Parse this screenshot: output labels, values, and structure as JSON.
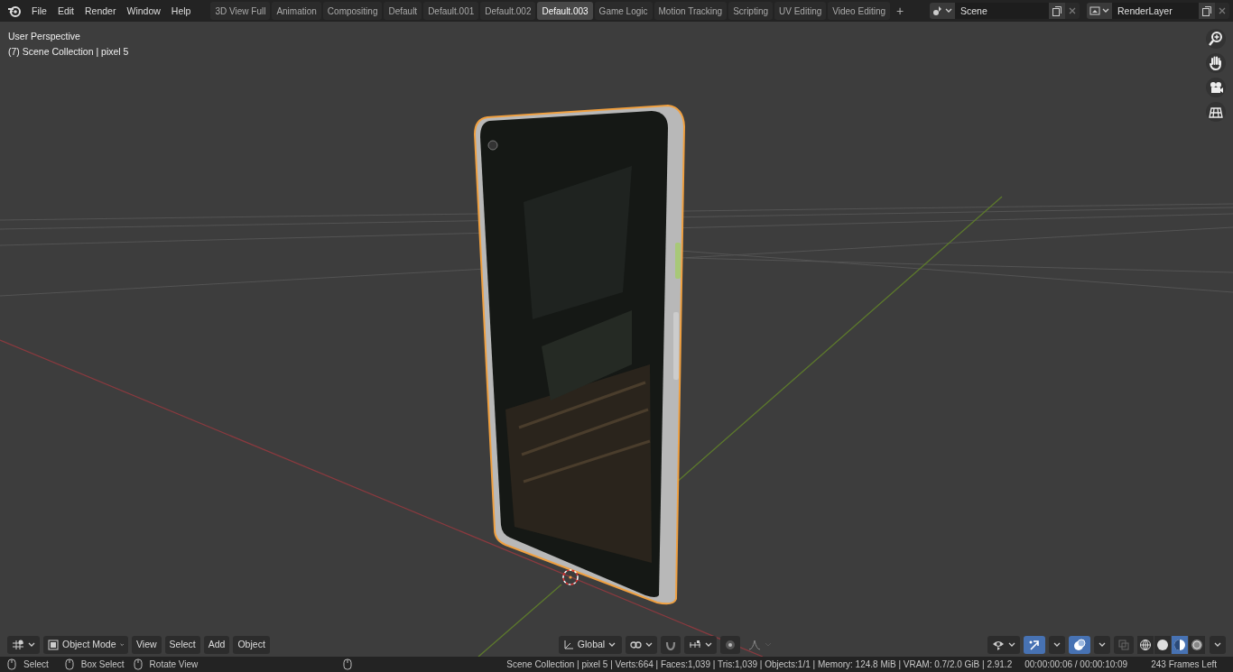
{
  "menu": [
    "File",
    "Edit",
    "Render",
    "Window",
    "Help"
  ],
  "workspaces": [
    {
      "label": "3D View Full",
      "selected": false
    },
    {
      "label": "Animation",
      "selected": false
    },
    {
      "label": "Compositing",
      "selected": false
    },
    {
      "label": "Default",
      "selected": false
    },
    {
      "label": "Default.001",
      "selected": false
    },
    {
      "label": "Default.002",
      "selected": false
    },
    {
      "label": "Default.003",
      "selected": true
    },
    {
      "label": "Game Logic",
      "selected": false
    },
    {
      "label": "Motion Tracking",
      "selected": false
    },
    {
      "label": "Scripting",
      "selected": false
    },
    {
      "label": "UV Editing",
      "selected": false
    },
    {
      "label": "Video Editing",
      "selected": false
    }
  ],
  "add_workspace": "+",
  "scene": {
    "value": "Scene"
  },
  "view_layer": {
    "value": "RenderLayer"
  },
  "viewport": {
    "perspective": "User Perspective",
    "collection": "(7) Scene Collection | pixel 5"
  },
  "header": {
    "mode": "Object Mode",
    "menus": [
      "View",
      "Select",
      "Add",
      "Object"
    ],
    "orientation": "Global",
    "snap_on": false,
    "gizmos_on": true,
    "overlays_on": true,
    "xray_on": false,
    "shading": [
      {
        "selected": false
      },
      {
        "selected": false
      },
      {
        "selected": true
      },
      {
        "selected": false
      }
    ]
  },
  "status": {
    "hints": [
      {
        "label": "Select"
      },
      {
        "label": "Box Select"
      },
      {
        "label": "Rotate View"
      }
    ],
    "stats": "Scene Collection | pixel 5 | Verts:664 | Faces:1,039 | Tris:1,039 | Objects:1/1 | Memory: 124.8 MiB | VRAM: 0.7/2.0 GiB | 2.91.2",
    "time": "00:00:00:06 / 00:00:10:09",
    "frames_left": "243 Frames Left"
  }
}
